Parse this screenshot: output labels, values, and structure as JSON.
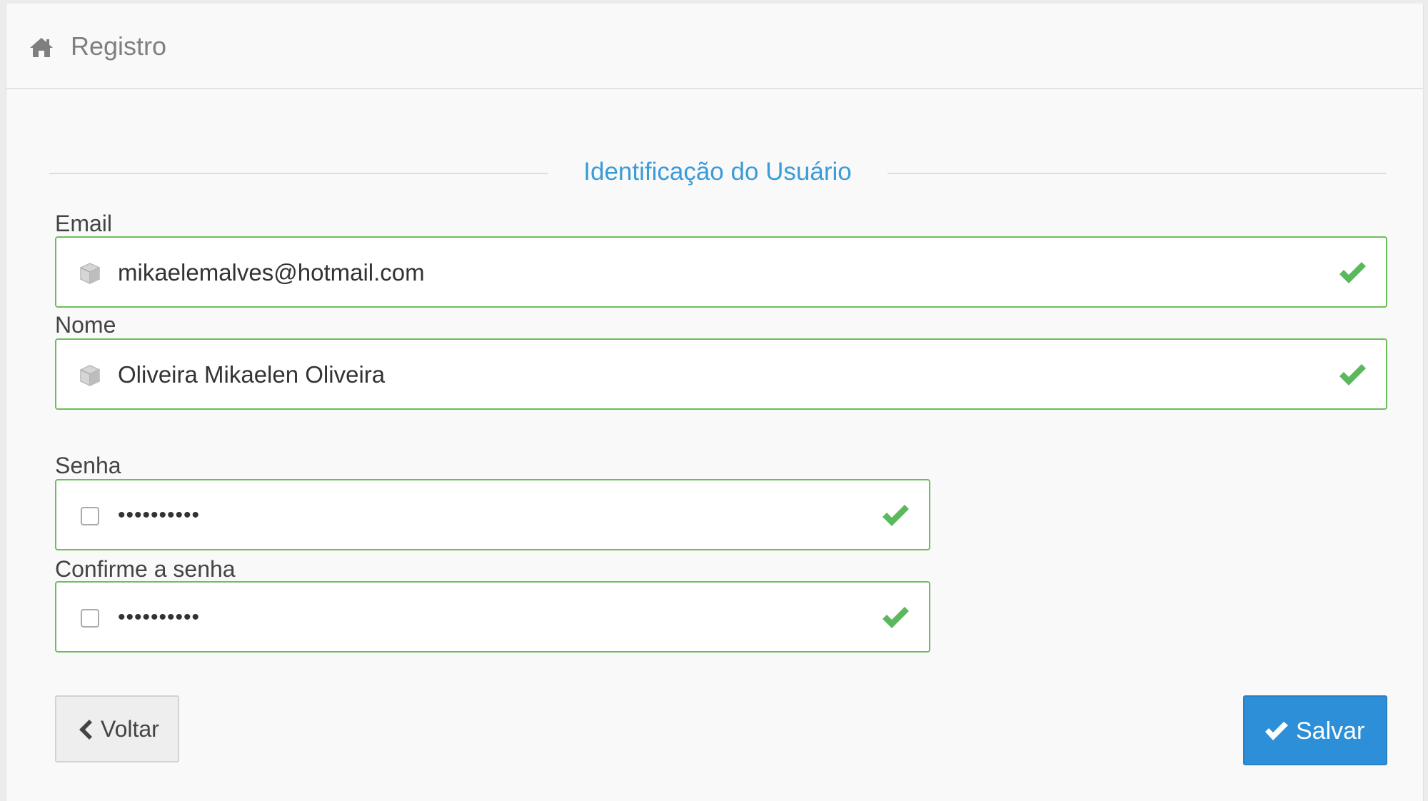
{
  "header": {
    "title": "Registro",
    "icon": "home-icon"
  },
  "section": {
    "legend": "Identificação do Usuário"
  },
  "fields": {
    "email": {
      "label": "Email",
      "value": "mikaelemalves@hotmail.com",
      "icon": "cube-icon",
      "status": "valid"
    },
    "name": {
      "label": "Nome",
      "value": "Oliveira Mikaelen Oliveira",
      "icon": "cube-icon",
      "status": "valid"
    },
    "password": {
      "label": "Senha",
      "value": "••••••••••",
      "icon": "square-icon",
      "status": "valid"
    },
    "confirm_password": {
      "label": "Confirme a senha",
      "value": "••••••••••",
      "icon": "square-icon",
      "status": "valid"
    }
  },
  "actions": {
    "back_label": "Voltar",
    "save_label": "Salvar"
  },
  "colors": {
    "accent": "#3a9bd9",
    "valid": "#6bbf59",
    "primary_button": "#2d8fd8"
  }
}
